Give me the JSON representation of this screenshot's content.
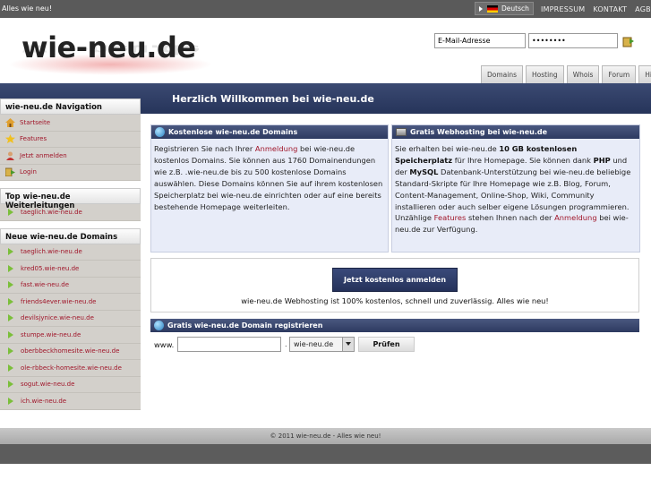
{
  "topbar": {
    "tagline": "Alles wie neu!",
    "language": "Deutsch",
    "links": [
      "IMPRESSUM",
      "KONTAKT",
      "AGB"
    ]
  },
  "header": {
    "logo": "wie-neu.de",
    "email_value": "E-Mail-Adresse",
    "password_value": "••••••••",
    "tabs": [
      "Domains",
      "Hosting",
      "Whois",
      "Forum",
      "Hilfe"
    ]
  },
  "banner": {
    "title": "Herzlich Willkommen bei wie-neu.de"
  },
  "sidebar": {
    "nav_title": "wie-neu.de Navigation",
    "nav_items": [
      {
        "label": "Startseite",
        "icon": "home-icon"
      },
      {
        "label": "Features",
        "icon": "star-icon"
      },
      {
        "label": "Jetzt anmelden",
        "icon": "user-icon"
      },
      {
        "label": "Login",
        "icon": "login-icon"
      }
    ],
    "top_title": "Top wie-neu.de Weiterleitungen",
    "top_items": [
      "taeglich.wie-neu.de"
    ],
    "new_title": "Neue wie-neu.de Domains",
    "new_items": [
      "taeglich.wie-neu.de",
      "kred05.wie-neu.de",
      "fast.wie-neu.de",
      "friends4ever.wie-neu.de",
      "devilsjynice.wie-neu.de",
      "stumpe.wie-neu.de",
      "oberbbeckhomesite.wie-neu.de",
      "ole-rbbeck-homesite.wie-neu.de",
      "sogut.wie-neu.de",
      "ich.wie-neu.de"
    ]
  },
  "domains_box": {
    "title": "Kostenlose wie-neu.de Domains",
    "t1": "Registrieren Sie nach Ihrer ",
    "link": "Anmeldung",
    "t2": " bei wie-neu.de kostenlos Domains. Sie können aus 1760 Domainendungen wie z.B. .wie-neu.de bis zu 500 kostenlose Domains auswählen. Diese Domains können Sie auf ihrem kostenlosen Speicherplatz bei wie-neu.de einrichten oder auf eine bereits bestehende Homepage weiterleiten."
  },
  "hosting_box": {
    "title": "Gratis Webhosting bei wie-neu.de",
    "t1": "Sie erhalten bei wie-neu.de ",
    "b1": "10 GB kostenlosen Speicherplatz",
    "t2": " für Ihre Homepage. Sie können dank ",
    "b2": "PHP",
    "t3": " und der ",
    "b3": "MySQL",
    "t4": " Datenbank-Unterstützung bei wie-neu.de beliebige Standard-Skripte für Ihre Homepage wie z.B. Blog, Forum, Content-Management, Online-Shop, Wiki, Community installieren oder auch selber eigene Lösungen programmieren.",
    "t5": "Unzählige ",
    "link1": "Features",
    "t6": " stehen Ihnen nach der ",
    "link2": "Anmeldung",
    "t7": " bei wie-neu.de zur Verfügung."
  },
  "signup": {
    "button": "Jetzt kostenlos anmelden",
    "text": "wie-neu.de Webhosting ist 100% kostenlos, schnell und zuverlässig. Alles wie neu!"
  },
  "register": {
    "title": "Gratis wie-neu.de Domain registrieren",
    "www": "www.",
    "dot": ".",
    "tld": "wie-neu.de",
    "check": "Prüfen"
  },
  "footer": {
    "text": "© 2011 wie-neu.de - Alles wie neu!"
  }
}
